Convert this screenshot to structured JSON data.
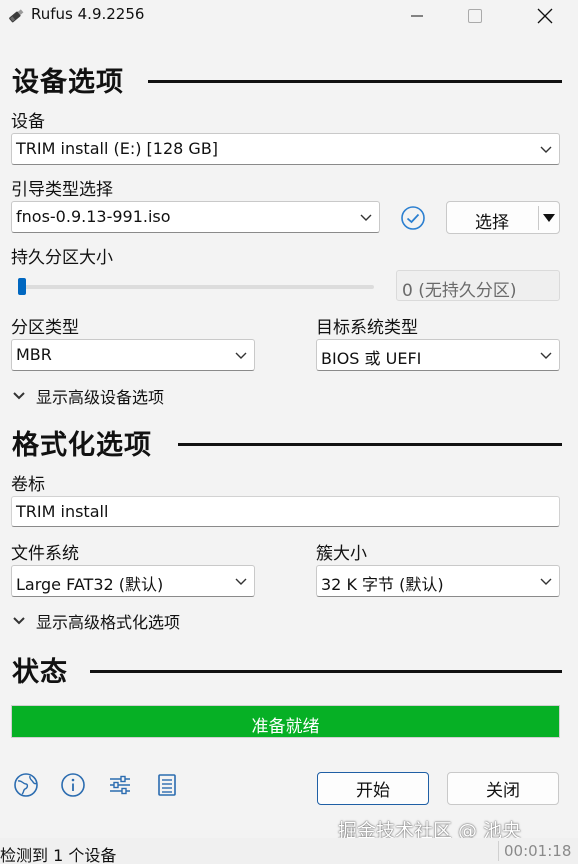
{
  "window": {
    "title": "Rufus 4.9.2256",
    "icons": [
      "usb-drive-icon",
      "minimize-icon",
      "maximize-icon",
      "close-icon"
    ]
  },
  "device_section": {
    "title": "设备选项",
    "device_label": "设备",
    "device_value": "TRIM install (E:) [128 GB]",
    "boot_label": "引导类型选择",
    "boot_value": "fnos-0.9.13-991.iso",
    "select_button": "选择",
    "persistent_label": "持久分区大小",
    "persistent_value": "0 (无持久分区)",
    "persistent_level": 0,
    "partition_label": "分区类型",
    "partition_value": "MBR",
    "target_label": "目标系统类型",
    "target_value": "BIOS 或 UEFI",
    "advanced_toggle": "显示高级设备选项"
  },
  "format_section": {
    "title": "格式化选项",
    "volume_label": "卷标",
    "volume_value": "TRIM install",
    "fs_label": "文件系统",
    "fs_value": "Large FAT32 (默认)",
    "cluster_label": "簇大小",
    "cluster_value": "32 K 字节 (默认)",
    "advanced_toggle": "显示高级格式化选项"
  },
  "status_section": {
    "title": "状态",
    "progress_text": "准备就绪",
    "progress_fraction": 1.0,
    "progress_color": "#06b025"
  },
  "toolbar": {
    "icons": [
      "globe-icon",
      "info-icon",
      "settings-sliders-icon",
      "log-icon"
    ],
    "start_button": "开始",
    "close_button": "关闭"
  },
  "statusbar": {
    "text": "检测到 1 个设备",
    "elapsed": "00:01:18"
  },
  "watermark": "掘金技术社区 @ 池央",
  "colors": {
    "accent": "#0067c0",
    "progress": "#06b025",
    "check": "#2b7fd0"
  }
}
